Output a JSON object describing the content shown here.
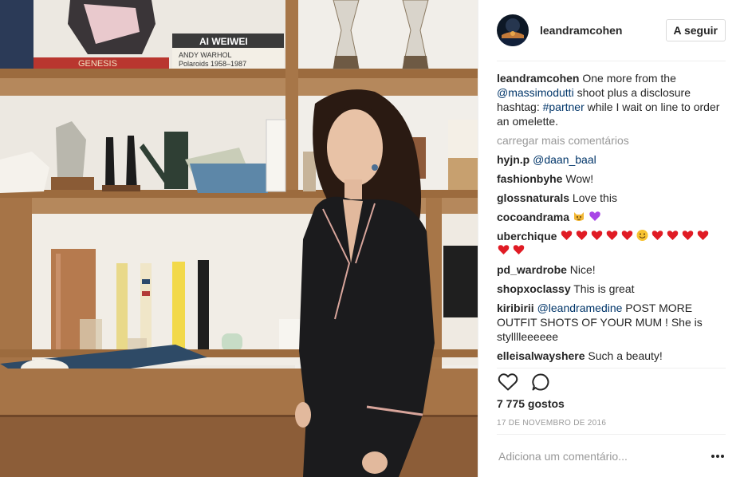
{
  "post": {
    "username": "leandramcohen",
    "follow_label": "A seguir",
    "caption": {
      "user": "leandramcohen",
      "text_1": " One more from the ",
      "mention": "@massimodutti",
      "text_2": " shoot plus a disclosure hashtag: ",
      "hashtag": "#partner",
      "text_3": " while I wait on line to order an omelette."
    },
    "load_more": "carregar mais comentários",
    "comments": [
      {
        "user": "hyjn.p",
        "mention": "@daan_baal",
        "text": ""
      },
      {
        "user": "fashionbyhe",
        "text": "Wow!"
      },
      {
        "user": "glossnaturals",
        "text": "Love this"
      },
      {
        "user": "cocoandrama",
        "text": "",
        "emojis": [
          "happy-cat-emoji",
          "purple-heart-emoji"
        ]
      },
      {
        "user": "uberchique",
        "text": "",
        "emojis": [
          "red-heart x5",
          "smiley",
          "red-heart x6"
        ]
      },
      {
        "user": "pd_wardrobe",
        "text": "Nice!"
      },
      {
        "user": "shopxoclassy",
        "text": "This is great"
      },
      {
        "user": "kiribirii",
        "mention": "@leandramedine",
        "text": " POST MORE OUTFIT SHOTS OF YOUR MUM ! She is stylllleeeeee"
      },
      {
        "user": "elleisalwayshere",
        "text": "Such a beauty!"
      }
    ],
    "likes": "7 775 gostos",
    "date": "17 DE NOVEMBRO DE 2016",
    "comment_placeholder": "Adiciona um comentário...",
    "photo_texts": {
      "book_genesis": "GENESIS",
      "book_aiweiwei": "AI WEIWEI",
      "book_warhol_1": "ANDY WARHOL",
      "book_warhol_2": "Polaroids 1958–1987"
    }
  },
  "colors": {
    "link": "#003569",
    "muted": "#999999",
    "text": "#262626",
    "border": "#efefef"
  }
}
